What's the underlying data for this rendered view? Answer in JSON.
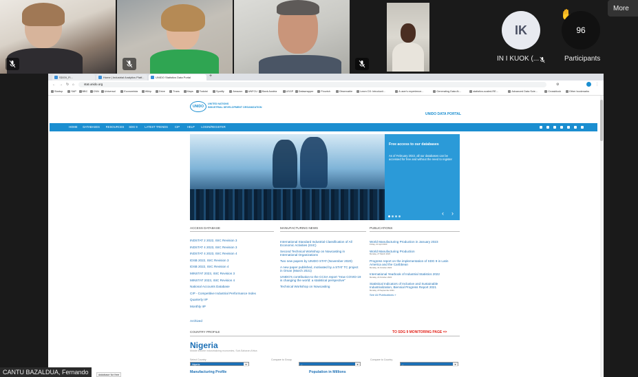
{
  "meeting": {
    "more_label": "More",
    "ik_initials": "IK",
    "ik_name": "IN I KUOK (...",
    "participants_count": "96",
    "participants_label": "Participants",
    "active_speaker": "CANTU BAZALDUA, Fernando",
    "colors": {
      "ik_avatar": "#e8eaf0",
      "participants_circle": "#111111"
    }
  },
  "browser": {
    "tabs": [
      "SDG9_Fl...",
      "Home | Industrial Analytics Platf...",
      "UNIDO Statistics Data Portal"
    ],
    "new_tab_label": "+",
    "url": "stat.unido.org",
    "bookmarks": [
      "Startup",
      "SAP",
      "BBC",
      "CNN",
      "Universal",
      "Economista",
      "Wikip",
      "Drive",
      "Trans",
      "Maps",
      "Todoist",
      "Spotify",
      "Amazon",
      "UNFCU",
      "Bank Austria",
      "USGP",
      "Datawrapper",
      "Flourish",
      "Observable",
      "Learn D3: Introducti...",
      "A user's experience...",
      "Generating Data At...",
      "statistics-scaled-RE...",
      "Advanced Data Scie...",
      "Crossblock",
      "Other bookmarks"
    ]
  },
  "site": {
    "logo_text": "UNIDO",
    "org_line1": "UNITED NATIONS",
    "org_line2": "INDUSTRIAL DEVELOPMENT ORGANIZATION",
    "portal_label": "UNIDO DATA PORTAL",
    "menu": [
      "HOME",
      "DATABASES",
      "RESOURCES",
      "SDG 9",
      "LATEST TRENDS",
      "CIP",
      "HELP",
      "LOGIN/REGISTER"
    ],
    "hero_title": "Free access to our databases",
    "hero_text": "As of February 2022, all our databases can be accessed for free and without the need to register",
    "access_head": "ACCESS DATABASE",
    "access_links": [
      "INDSTAT 2 2022, ISIC Revision 3",
      "INDSTAT 4 2023, ISIC Revision 3",
      "INDSTAT 4 2023, ISIC Revision 4",
      "IDSB 2022, ISIC Revision 3",
      "IDSB 2022, ISIC Revision 4",
      "MINSTAT 2023, ISIC Revision 3",
      "MINSTAT 2023, ISIC Revision 4",
      "National Accounts Database",
      "CIP - Competitive Industrial Performance Index",
      "Quarterly IIP",
      "Monthly IIP"
    ],
    "archived": "Archived",
    "news_head": "MANUFACTURING NEWS",
    "news_links": [
      [
        "International Standard Industrial Classification of All",
        "Economic Activities (ISIC)"
      ],
      [
        "Second Technical Workshop on Nowcasting in",
        "International Organizations"
      ],
      [
        "Two new papers by UNIDO STAT (November 2020)"
      ],
      [
        "A new paper published, motivated by a STAT TC project",
        "in Oman (March 2021)"
      ],
      [
        "UNIDO's contribution to the CCSA report \"How COVID-19",
        "is changing the world: a statistical perspective\""
      ],
      [
        "Technical Workshop on Nowcasting"
      ]
    ],
    "pub_head": "PUBLICATIONS",
    "pubs": [
      {
        "title": [
          "World Manufacturing Production in January 2023"
        ],
        "date": "Friday, 21 April 2023"
      },
      {
        "title": [
          "World Manufacturing Production"
        ],
        "date": "Monday, 27 March 2023"
      },
      {
        "title": [
          "Progress report on the implementation of SDG 9 in Latin",
          "America and the Caribbean"
        ],
        "date": "Monday, 31 October 2022"
      },
      {
        "title": [
          "International Yearbook of Industrial Statistics 2022"
        ],
        "date": "Monday, 24 October 2022"
      },
      {
        "title": [
          "Statistical Indicators of Inclusive and Sustainable",
          "Industrialization, Biennial Progress Report 2021"
        ],
        "date": "Monday, 20 September 2021"
      }
    ],
    "see_all": "See All Publications »",
    "country_head": "COUNTRY PROFILE",
    "sdg_link": "TO SDG 9 MONITORING PAGE =>",
    "country": "Nigeria",
    "country_sub": "Middle income industrializing economies, Sub-Saharan Africa",
    "select_country_label": "Select Country",
    "select_country_value": "Nigeria",
    "compare_group_label": "Compare to Group",
    "compare_country_label": "Compare to Country",
    "dash": "--",
    "manufacturing_profile": "Manufacturing Profile",
    "population": "Population in Millions",
    "tooltip": "database for free",
    "colors": {
      "brand_blue": "#1b8ed0",
      "link_blue": "#1b6fb5",
      "sdg_red": "#e2231a"
    }
  }
}
